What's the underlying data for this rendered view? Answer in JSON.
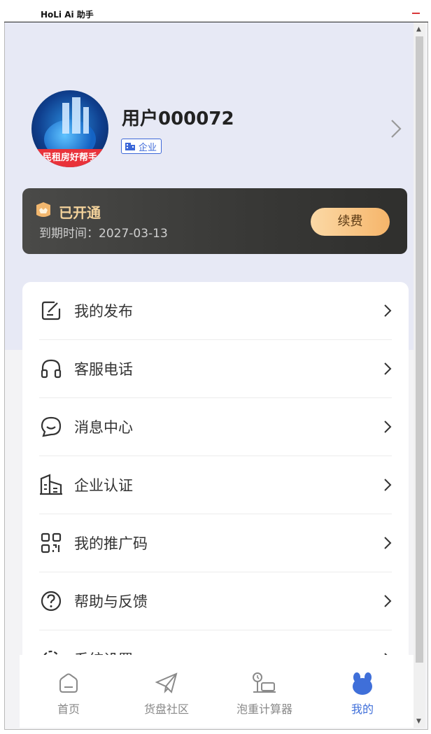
{
  "window": {
    "title": "HoLi Ai 助手"
  },
  "profile": {
    "username": "用户000072",
    "badge": "企业",
    "avatar_banner": "民租房好帮手"
  },
  "vip": {
    "status": "已开通",
    "expiry_label": "到期时间：2027-03-13",
    "renew_button": "续费"
  },
  "menu": [
    {
      "label": "我的发布",
      "icon": "edit-icon"
    },
    {
      "label": "客服电话",
      "icon": "headphones-icon"
    },
    {
      "label": "消息中心",
      "icon": "chat-bubble-icon"
    },
    {
      "label": "企业认证",
      "icon": "building-icon"
    },
    {
      "label": "我的推广码",
      "icon": "qrcode-icon"
    },
    {
      "label": "帮助与反馈",
      "icon": "help-icon"
    },
    {
      "label": "系统设置",
      "icon": "settings-icon"
    }
  ],
  "tabbar": [
    {
      "label": "首页",
      "icon": "home-icon"
    },
    {
      "label": "货盘社区",
      "icon": "paper-plane-icon"
    },
    {
      "label": "泡重计算器",
      "icon": "scale-icon"
    },
    {
      "label": "我的",
      "icon": "profile-bear-icon",
      "active": true
    }
  ],
  "colors": {
    "accent": "#3f6fd9",
    "vip_gold": "#f3d29b",
    "hero_bg": "#e7e9f5",
    "minimize": "#d9383a"
  }
}
